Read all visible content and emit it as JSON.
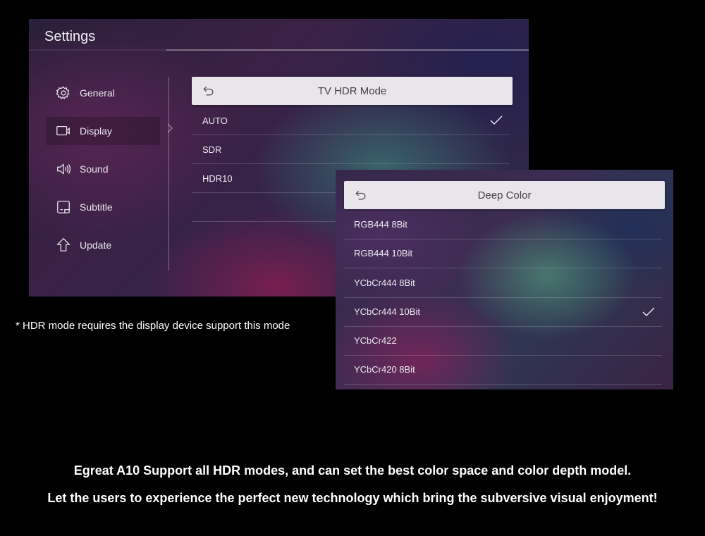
{
  "settings": {
    "title": "Settings",
    "sidebar": {
      "items": [
        {
          "label": "General",
          "icon": "gear-icon"
        },
        {
          "label": "Display",
          "icon": "display-icon",
          "selected": true
        },
        {
          "label": "Sound",
          "icon": "speaker-icon"
        },
        {
          "label": "Subtitle",
          "icon": "subtitle-icon"
        },
        {
          "label": "Update",
          "icon": "update-arrow-icon"
        }
      ]
    },
    "panel": {
      "title": "TV HDR Mode",
      "back_icon": "back-arrow-icon",
      "options": [
        {
          "label": "AUTO",
          "checked": true
        },
        {
          "label": "SDR",
          "checked": false
        },
        {
          "label": "HDR10",
          "checked": false
        },
        {
          "label": "",
          "checked": false
        }
      ]
    }
  },
  "deep_color": {
    "title": "Deep Color",
    "back_icon": "back-arrow-icon",
    "options": [
      {
        "label": "RGB444 8Bit",
        "checked": false
      },
      {
        "label": "RGB444 10Bit",
        "checked": false
      },
      {
        "label": "YCbCr444 8Bit",
        "checked": false
      },
      {
        "label": "YCbCr444 10Bit",
        "checked": true
      },
      {
        "label": "YCbCr422",
        "checked": false
      },
      {
        "label": "YCbCr420 8Bit",
        "checked": false
      }
    ]
  },
  "note": "* HDR mode requires the display device support this mode",
  "captions": {
    "line1": "Egreat A10 Support all HDR modes, and can set the best color space and color depth model.",
    "line2": "Let the users to experience the perfect new technology which bring the subversive visual enjoyment!"
  },
  "colors": {
    "background": "#000000",
    "header_bar": "#e8e6ea",
    "text": "#ece9f1"
  }
}
